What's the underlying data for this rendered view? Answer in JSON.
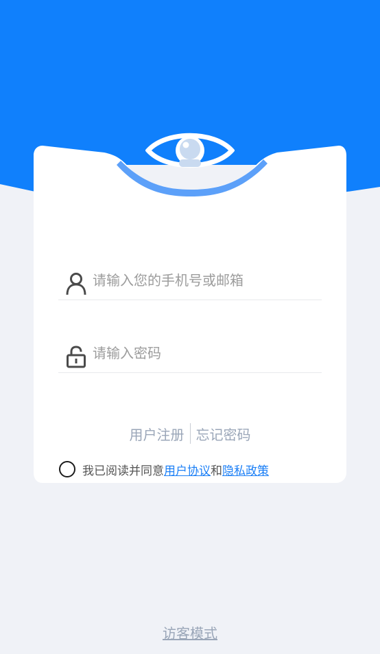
{
  "colors": {
    "brand": "#1080fc",
    "background": "#f0f2f7",
    "card": "#ffffff",
    "link": "#1b7ff6",
    "muted": "#9aa6b8"
  },
  "icons": {
    "logo": "eye-logo-icon",
    "account": "user-icon",
    "password": "lock-open-icon",
    "agreement": "radio-circle-icon"
  },
  "login": {
    "account_placeholder": "请输入您的手机号或邮箱",
    "password_placeholder": "请输入密码"
  },
  "links": {
    "register": "用户注册",
    "forgot": "忘记密码"
  },
  "agreement": {
    "prefix": "我已阅读并同意",
    "user_agreement": "用户协议",
    "and": "和",
    "privacy_policy": "隐私政策"
  },
  "guest_mode": "访客模式"
}
